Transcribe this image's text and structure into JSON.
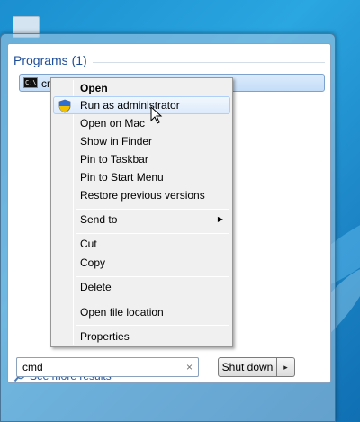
{
  "start_menu": {
    "programs_header": "Programs (1)",
    "results": [
      {
        "label": "cmd",
        "icon": "cmd-icon"
      }
    ],
    "see_more_label": "See more results",
    "search": {
      "value": "cmd",
      "clear_glyph": "×"
    },
    "shutdown_label": "Shut down",
    "shutdown_arrow_glyph": "▸"
  },
  "context_menu": {
    "items": [
      {
        "label": "Open",
        "bold": true
      },
      {
        "label": "Run as administrator",
        "icon": "shield-icon",
        "highlighted": true
      },
      {
        "label": "Open on Mac"
      },
      {
        "label": "Show in Finder"
      },
      {
        "label": "Pin to Taskbar"
      },
      {
        "label": "Pin to Start Menu"
      },
      {
        "label": "Restore previous versions"
      },
      {
        "label": "Send to",
        "submenu": true
      },
      {
        "label": "Cut"
      },
      {
        "label": "Copy"
      },
      {
        "label": "Delete"
      },
      {
        "label": "Open file location"
      },
      {
        "label": "Properties"
      }
    ],
    "submenu_glyph": "▶"
  }
}
